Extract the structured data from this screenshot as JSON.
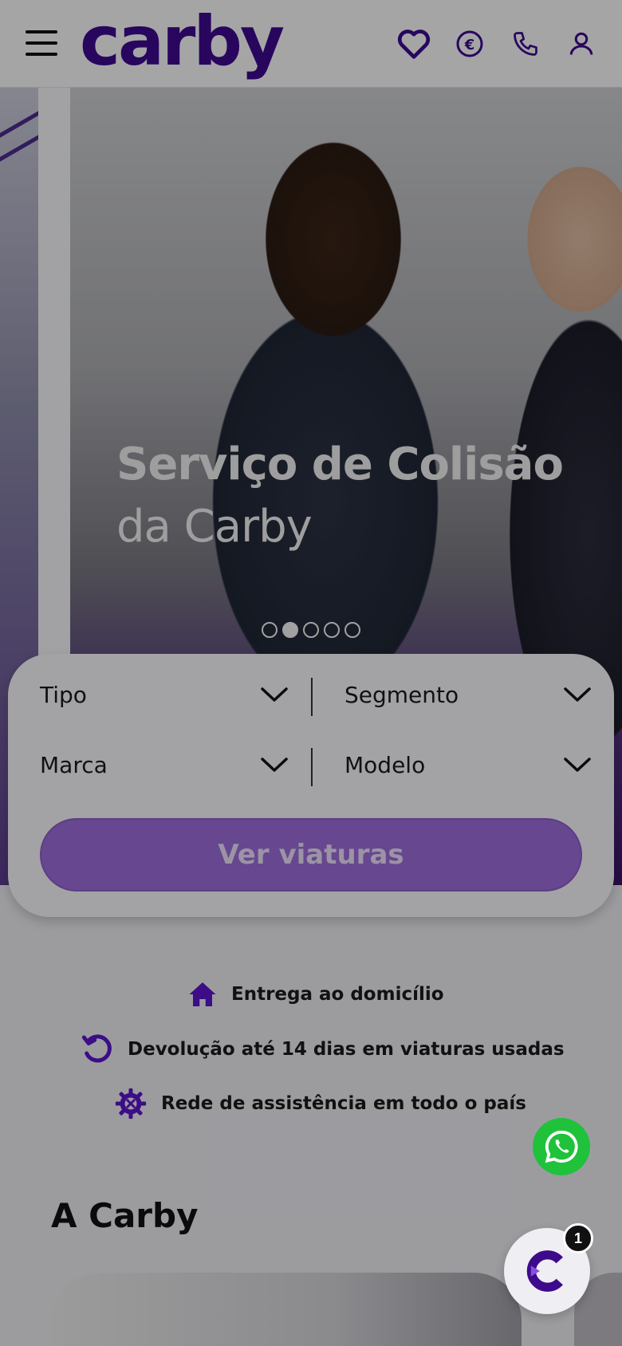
{
  "header": {
    "logo_text": "carby",
    "icons": [
      "menu-icon",
      "heart-icon",
      "euro-icon",
      "phone-icon",
      "user-icon"
    ]
  },
  "hero": {
    "title": "Serviço de Colisão",
    "subtitle": "da Carby",
    "slides_total": 5,
    "active_slide": 2
  },
  "filters": {
    "tipo": "Tipo",
    "segmento": "Segmento",
    "marca": "Marca",
    "modelo": "Modelo",
    "cta_label": "Ver viaturas"
  },
  "features": [
    {
      "icon": "home-icon",
      "text": "Entrega ao domicílio"
    },
    {
      "icon": "return-icon",
      "text": "Devolução até 14 dias em viaturas usadas"
    },
    {
      "icon": "gear-icon",
      "text": "Rede de assistência em todo o país"
    }
  ],
  "about": {
    "title": "A Carby"
  },
  "chat": {
    "badge": "1"
  },
  "colors": {
    "brand": "#3d0a8c",
    "accent": "#9a6bd6",
    "whatsapp": "#1fc23a"
  }
}
